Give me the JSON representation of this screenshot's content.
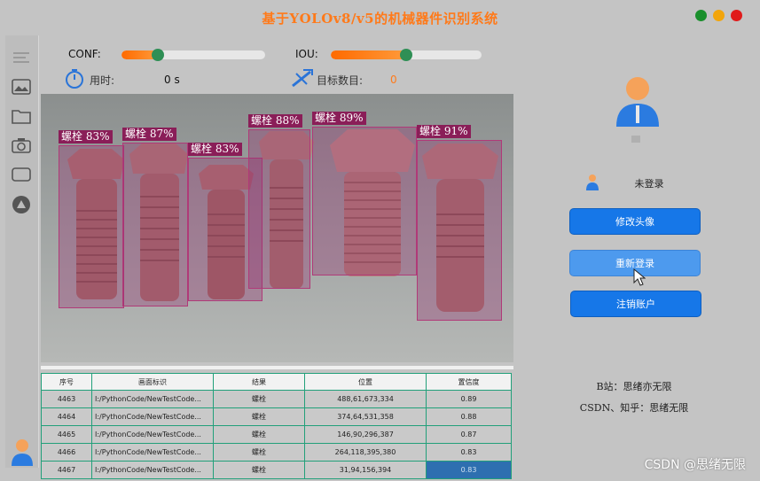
{
  "window": {
    "title": "基于YOLOv8/v5的机械器件识别系统",
    "controls": [
      {
        "name": "maximize",
        "color": "#1a8f2c"
      },
      {
        "name": "minimize",
        "color": "#f2a50c"
      },
      {
        "name": "close",
        "color": "#e01b1b"
      }
    ]
  },
  "sidebar": {
    "items": [
      "menu-icon",
      "image-icon",
      "folder-icon",
      "camera-icon",
      "screen-icon",
      "model-icon"
    ],
    "avatar": "user-avatar-icon"
  },
  "params": {
    "conf_label": "CONF:",
    "conf_value": 0.25,
    "iou_label": "IOU:",
    "iou_value": 0.5,
    "time_label": "用时:",
    "time_value": "0 s",
    "count_label": "目标数目:",
    "count_value": "0"
  },
  "detections": [
    {
      "label": "螺栓 83%"
    },
    {
      "label": "螺栓 87%"
    },
    {
      "label": "螺栓 83%"
    },
    {
      "label": "螺栓 88%"
    },
    {
      "label": "螺栓 89%"
    },
    {
      "label": "螺栓 91%"
    }
  ],
  "table": {
    "headers": [
      "序号",
      "画面标识",
      "结果",
      "位置",
      "置信度"
    ],
    "rows": [
      [
        "4463",
        "I:/PythonCode/NewTestCode...",
        "螺栓",
        "488,61,673,334",
        "0.89"
      ],
      [
        "4464",
        "I:/PythonCode/NewTestCode...",
        "螺栓",
        "374,64,531,358",
        "0.88"
      ],
      [
        "4465",
        "I:/PythonCode/NewTestCode...",
        "螺栓",
        "146,90,296,387",
        "0.87"
      ],
      [
        "4466",
        "I:/PythonCode/NewTestCode...",
        "螺栓",
        "264,118,395,380",
        "0.83"
      ],
      [
        "4467",
        "I:/PythonCode/NewTestCode...",
        "螺栓",
        "31,94,156,394",
        "0.83"
      ]
    ],
    "selected_row": 4
  },
  "account": {
    "status": "未登录",
    "btn_change_avatar": "修改头像",
    "btn_relogin": "重新登录",
    "btn_logout": "注销账户",
    "info_bilibili": "B站：思绪亦无限",
    "info_csdn": "CSDN、知乎：思绪无限"
  },
  "watermark": "CSDN @思绪无限"
}
